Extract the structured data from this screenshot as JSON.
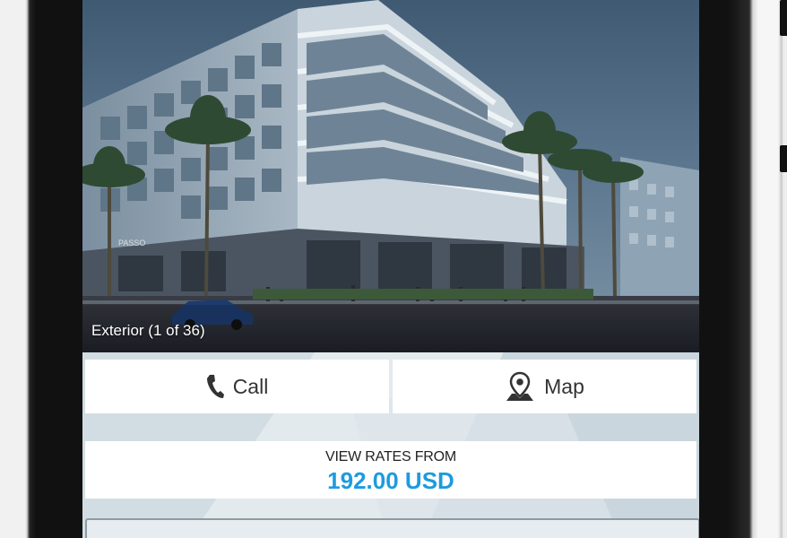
{
  "photo": {
    "caption": "Exterior (1 of 36)",
    "sign_text": "PASSO"
  },
  "actions": {
    "call_label": "Call",
    "map_label": "Map"
  },
  "rates": {
    "label": "VIEW RATES FROM",
    "price": "192.00 USD"
  },
  "colors": {
    "price_blue": "#1d9be0",
    "button_bg": "#ffffff",
    "bezel": "#111111"
  },
  "icons": {
    "call": "phone-icon",
    "map": "map-pin-icon"
  }
}
